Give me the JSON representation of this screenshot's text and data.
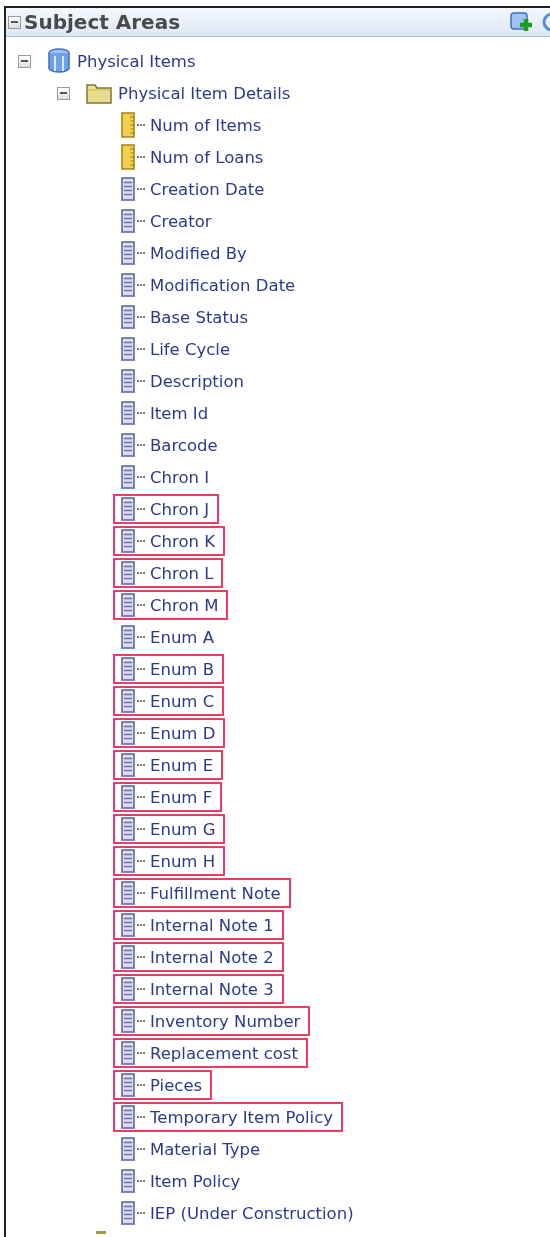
{
  "panel": {
    "title": "Subject Areas",
    "expanded": true
  },
  "tree": [
    {
      "label": "Physical Items",
      "kind": "subject",
      "expanded": true,
      "children": [
        {
          "label": "Physical Item Details",
          "kind": "folder",
          "expanded": true,
          "children": [
            {
              "label": "Num of Items",
              "kind": "measure",
              "highlighted": false
            },
            {
              "label": "Num of Loans",
              "kind": "measure",
              "highlighted": false
            },
            {
              "label": "Creation Date",
              "kind": "attribute",
              "highlighted": false
            },
            {
              "label": "Creator",
              "kind": "attribute",
              "highlighted": false
            },
            {
              "label": "Modified By",
              "kind": "attribute",
              "highlighted": false
            },
            {
              "label": "Modification Date",
              "kind": "attribute",
              "highlighted": false
            },
            {
              "label": "Base Status",
              "kind": "attribute",
              "highlighted": false
            },
            {
              "label": "Life Cycle",
              "kind": "attribute",
              "highlighted": false
            },
            {
              "label": "Description",
              "kind": "attribute",
              "highlighted": false
            },
            {
              "label": "Item Id",
              "kind": "attribute",
              "highlighted": false
            },
            {
              "label": "Barcode",
              "kind": "attribute",
              "highlighted": false
            },
            {
              "label": "Chron I",
              "kind": "attribute",
              "highlighted": false
            },
            {
              "label": "Chron J",
              "kind": "attribute",
              "highlighted": true
            },
            {
              "label": "Chron K",
              "kind": "attribute",
              "highlighted": true
            },
            {
              "label": "Chron L",
              "kind": "attribute",
              "highlighted": true
            },
            {
              "label": "Chron M",
              "kind": "attribute",
              "highlighted": true
            },
            {
              "label": "Enum A",
              "kind": "attribute",
              "highlighted": false
            },
            {
              "label": "Enum B",
              "kind": "attribute",
              "highlighted": true
            },
            {
              "label": "Enum C",
              "kind": "attribute",
              "highlighted": true
            },
            {
              "label": "Enum D",
              "kind": "attribute",
              "highlighted": true
            },
            {
              "label": "Enum E",
              "kind": "attribute",
              "highlighted": true
            },
            {
              "label": "Enum F",
              "kind": "attribute",
              "highlighted": true
            },
            {
              "label": "Enum G",
              "kind": "attribute",
              "highlighted": true
            },
            {
              "label": "Enum H",
              "kind": "attribute",
              "highlighted": true
            },
            {
              "label": "Fulfillment Note",
              "kind": "attribute",
              "highlighted": true
            },
            {
              "label": "Internal Note 1",
              "kind": "attribute",
              "highlighted": true
            },
            {
              "label": "Internal Note 2",
              "kind": "attribute",
              "highlighted": true
            },
            {
              "label": "Internal Note 3",
              "kind": "attribute",
              "highlighted": true
            },
            {
              "label": "Inventory Number",
              "kind": "attribute",
              "highlighted": true
            },
            {
              "label": "Replacement cost",
              "kind": "attribute",
              "highlighted": true
            },
            {
              "label": "Pieces",
              "kind": "attribute",
              "highlighted": true
            },
            {
              "label": "Temporary Item Policy",
              "kind": "attribute",
              "highlighted": true
            },
            {
              "label": "Material Type",
              "kind": "attribute",
              "highlighted": false
            },
            {
              "label": "Item Policy",
              "kind": "attribute",
              "highlighted": false
            },
            {
              "label": "IEP (Under Construction)",
              "kind": "attribute",
              "highlighted": false
            }
          ]
        }
      ]
    }
  ]
}
